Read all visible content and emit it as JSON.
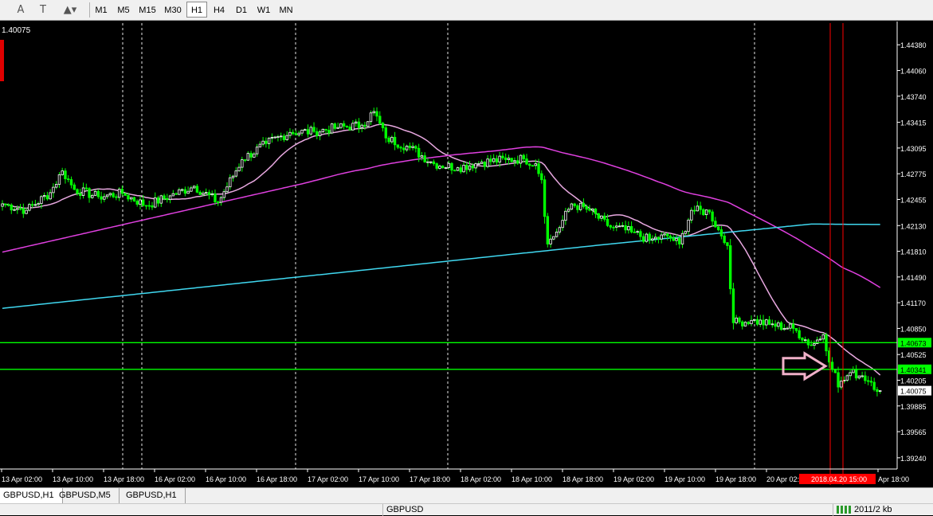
{
  "toolbar": {
    "icons": [
      "text-icon",
      "text-label-icon",
      "shapes-icon"
    ],
    "timeframes": [
      "M1",
      "M5",
      "M15",
      "M30",
      "H1",
      "H4",
      "D1",
      "W1",
      "MN"
    ],
    "active": "H1"
  },
  "chart": {
    "corner_price": "1.40075"
  },
  "chart_data": {
    "type": "candlestick",
    "symbol": "GBPUSD",
    "timeframe": "H1",
    "ylim": [
      1.391,
      1.4465
    ],
    "y_ticks": [
      "1.44380",
      "1.44060",
      "1.43740",
      "1.43415",
      "1.43095",
      "1.42775",
      "1.42455",
      "1.42130",
      "1.41810",
      "1.41490",
      "1.41170",
      "1.40850",
      "1.40525",
      "1.40205",
      "1.39885",
      "1.39565",
      "1.39240"
    ],
    "x_tick_labels": [
      "13 Apr 02:00",
      "13 Apr 10:00",
      "13 Apr 18:00",
      "16 Apr 02:00",
      "16 Apr 10:00",
      "16 Apr 18:00",
      "17 Apr 02:00",
      "17 Apr 10:00",
      "17 Apr 18:00",
      "18 Apr 02:00",
      "18 Apr 10:00",
      "18 Apr 18:00",
      "19 Apr 02:00",
      "19 Apr 10:00",
      "19 Apr 18:00",
      "20 Apr 02:00",
      "Apr 18:00"
    ],
    "x_cursor_label": "2018.04.20 15:00",
    "horizontal_lines": [
      {
        "price": 1.40673,
        "label": "1.40673",
        "color": "#00ff00"
      },
      {
        "price": 1.40341,
        "label": "1.40341",
        "color": "#00ff00"
      }
    ],
    "current_price": "1.40075",
    "anchors": [
      [
        0,
        1.424
      ],
      [
        8,
        1.4232
      ],
      [
        16,
        1.4254
      ],
      [
        20,
        1.4281
      ],
      [
        24,
        1.4258
      ],
      [
        32,
        1.4249
      ],
      [
        40,
        1.4253
      ],
      [
        48,
        1.4238
      ],
      [
        56,
        1.425
      ],
      [
        64,
        1.4262
      ],
      [
        72,
        1.4242
      ],
      [
        80,
        1.4295
      ],
      [
        88,
        1.4315
      ],
      [
        96,
        1.4329
      ],
      [
        104,
        1.433
      ],
      [
        112,
        1.4335
      ],
      [
        120,
        1.4338
      ],
      [
        124,
        1.4355
      ],
      [
        128,
        1.4322
      ],
      [
        136,
        1.431
      ],
      [
        144,
        1.429
      ],
      [
        152,
        1.4285
      ],
      [
        160,
        1.4292
      ],
      [
        168,
        1.4295
      ],
      [
        174,
        1.4296
      ],
      [
        178,
        1.429
      ],
      [
        180,
        1.427
      ],
      [
        182,
        1.419
      ],
      [
        185,
        1.4205
      ],
      [
        190,
        1.424
      ],
      [
        196,
        1.4232
      ],
      [
        202,
        1.4213
      ],
      [
        210,
        1.4205
      ],
      [
        216,
        1.4195
      ],
      [
        222,
        1.42
      ],
      [
        226,
        1.419
      ],
      [
        230,
        1.4232
      ],
      [
        236,
        1.423
      ],
      [
        240,
        1.42
      ],
      [
        242,
        1.4188
      ],
      [
        244,
        1.4092
      ],
      [
        250,
        1.4095
      ],
      [
        256,
        1.409
      ],
      [
        264,
        1.4085
      ],
      [
        270,
        1.4064
      ],
      [
        274,
        1.4077
      ],
      [
        277,
        1.4034
      ],
      [
        278,
        1.403
      ],
      [
        279,
        1.4012
      ],
      [
        283,
        1.403
      ],
      [
        287,
        1.4026
      ],
      [
        290,
        1.4018
      ],
      [
        293,
        1.40075
      ]
    ],
    "series": [
      {
        "name": "",
        "color": "#e8a8e0",
        "period": 20
      },
      {
        "name": "",
        "color": "#e040e0",
        "period": 100
      },
      {
        "name": "",
        "color": "#40d8f0",
        "period": 200
      }
    ],
    "colors": {
      "background": "#000000",
      "bull": "#ffffff",
      "bear": "#00ff00",
      "grid": "#ffffff",
      "axis": "#ffffff",
      "cursor": "#ff0000",
      "price_box": "#00ff00"
    },
    "annotation": {
      "shape": "arrow",
      "color": "#f0b0c8"
    }
  },
  "tabs": [
    "GBPUSD,H1",
    "GBPUSD,M5",
    "GBPUSD,H1"
  ],
  "status": {
    "symbol": "GBPUSD",
    "traffic": "2011/2 kb"
  }
}
